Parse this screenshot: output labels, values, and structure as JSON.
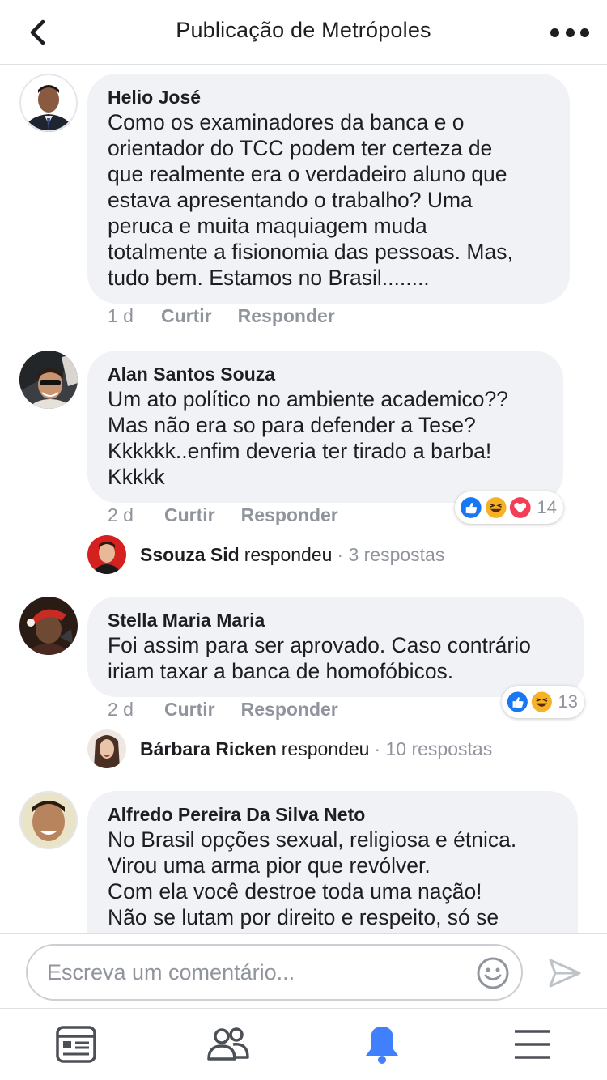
{
  "header": {
    "title": "Publicação de Metrópoles"
  },
  "comments": [
    {
      "author": "Helio José",
      "text": "Como os examinadores da banca e o\norientador do  TCC  podem ter certeza de\nque realmente era o verdadeiro aluno que\nestava apresentando o trabalho? Uma\nperuca e muita maquiagem muda\ntotalmente a fisionomia das pessoas. Mas,\ntudo bem. Estamos no Brasil........",
      "time": "1 d",
      "like_label": "Curtir",
      "reply_label": "Responder"
    },
    {
      "author": "Alan Santos Souza",
      "text": "Um ato político no ambiente academico??\nMas não era so para defender a Tese?\nKkkkkk..enfim deveria ter tirado a barba!\nKkkkk",
      "time": "2 d",
      "like_label": "Curtir",
      "reply_label": "Responder",
      "reactions": {
        "icons": [
          "like-icon",
          "haha-icon",
          "love-icon"
        ],
        "count": "14"
      },
      "reply": {
        "name": "Ssouza Sid",
        "verb": "respondeu",
        "count": "· 3 respostas"
      }
    },
    {
      "author": "Stella Maria Maria",
      "text": "Foi assim para ser aprovado. Caso contrário\niriam taxar a banca de homofóbicos.",
      "time": "2 d",
      "like_label": "Curtir",
      "reply_label": "Responder",
      "reactions": {
        "icons": [
          "like-icon",
          "haha-icon"
        ],
        "count": "13"
      },
      "reply": {
        "name": "Bárbara Ricken",
        "verb": "respondeu",
        "count": "· 10 respostas"
      }
    },
    {
      "author": "Alfredo Pereira Da Silva Neto",
      "text": "No Brasil opções sexual,  religiosa e étnica.\nVirou uma arma pior que revólver.\nCom ela você destroe toda uma nação!\nNão se lutam por direito e respeito, só se"
    }
  ],
  "composer": {
    "placeholder": "Escreva um comentário..."
  },
  "tabs": [
    "news-feed-icon",
    "friends-icon",
    "notifications-icon",
    "menu-icon"
  ],
  "colors": {
    "accent": "#4080ff",
    "like_blue": "#1877f2",
    "love_red": "#f33e58",
    "haha_yellow": "#f7b125",
    "bubble": "#f0f2f5",
    "meta_gray": "#90949c"
  }
}
